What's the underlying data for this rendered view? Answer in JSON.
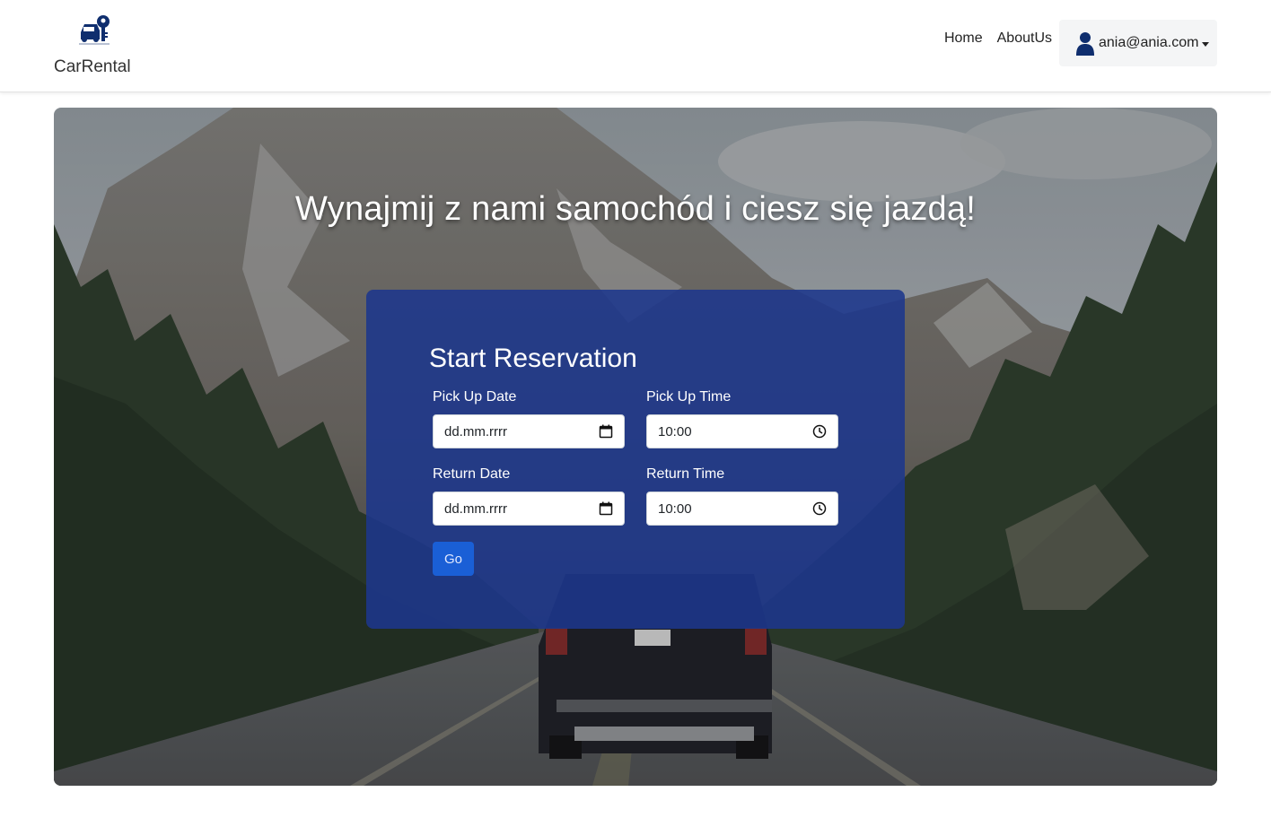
{
  "brand": {
    "name": "CarRental",
    "logo_icon": "car-key-icon",
    "accent": "#0f2e6e"
  },
  "nav": {
    "home": "Home",
    "about": "AboutUs",
    "user_email": "ania@ania.com",
    "user_icon": "user-icon"
  },
  "hero": {
    "title": "Wynajmij z nami samochód i ciesz się jazdą!"
  },
  "reservation": {
    "title": "Start Reservation",
    "pickup_date": {
      "label": "Pick Up Date",
      "value": "dd.mm.rrrr",
      "icon": "calendar-icon"
    },
    "pickup_time": {
      "label": "Pick Up Time",
      "value": "10:00",
      "icon": "clock-icon"
    },
    "return_date": {
      "label": "Return Date",
      "value": "dd.mm.rrrr",
      "icon": "calendar-icon"
    },
    "return_time": {
      "label": "Return Time",
      "value": "10:00",
      "icon": "clock-icon"
    },
    "go_label": "Go",
    "card_color": "#1c378c",
    "button_color": "#1a5fd6"
  }
}
